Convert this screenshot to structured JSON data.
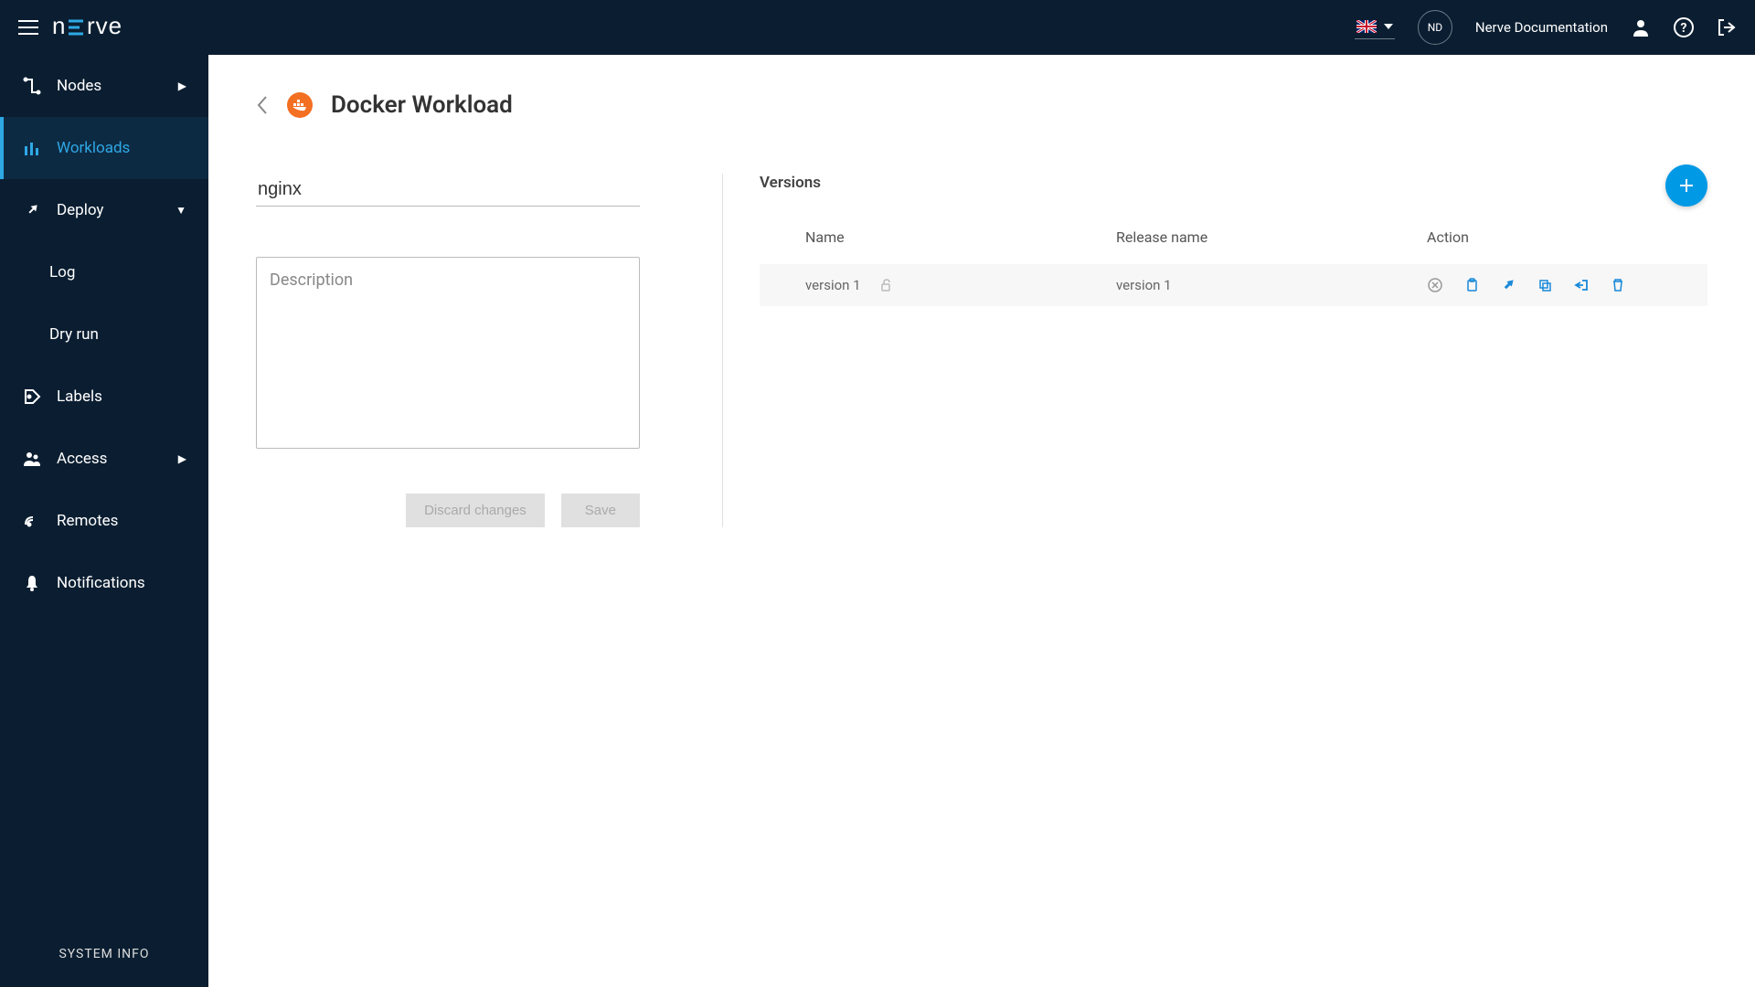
{
  "header": {
    "avatar_initials": "ND",
    "user_name": "Nerve Documentation"
  },
  "sidebar": {
    "items": [
      {
        "label": "Nodes",
        "icon": "nodes",
        "expandable": true
      },
      {
        "label": "Workloads",
        "icon": "workloads",
        "active": true
      },
      {
        "label": "Deploy",
        "icon": "deploy",
        "expandable": true,
        "expanded": true
      },
      {
        "label": "Labels",
        "icon": "labels"
      },
      {
        "label": "Access",
        "icon": "access",
        "expandable": true
      },
      {
        "label": "Remotes",
        "icon": "remotes"
      },
      {
        "label": "Notifications",
        "icon": "notifications"
      }
    ],
    "deploy_subitems": [
      {
        "label": "Log"
      },
      {
        "label": "Dry run"
      }
    ],
    "system_info": "SYSTEM INFO"
  },
  "page": {
    "title": "Docker Workload",
    "name_value": "nginx",
    "description_placeholder": "Description",
    "discard_label": "Discard changes",
    "save_label": "Save"
  },
  "versions": {
    "title": "Versions",
    "columns": {
      "name": "Name",
      "release": "Release name",
      "action": "Action"
    },
    "rows": [
      {
        "name": "version 1",
        "release": "version 1"
      }
    ]
  }
}
